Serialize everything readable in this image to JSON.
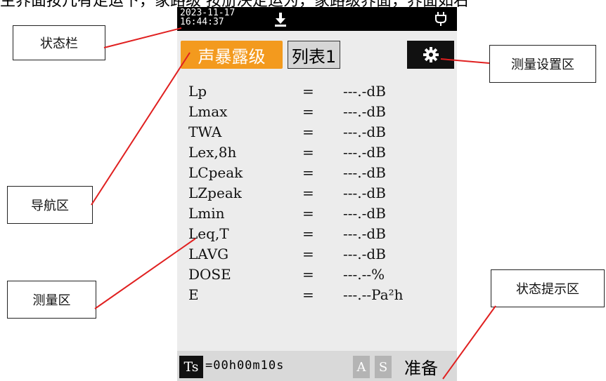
{
  "caption": "主界面按几有走运下，家路级 按册决定运为，家路级界面，界面如右",
  "callouts": {
    "status_bar": "状态栏",
    "navigation": "导航区",
    "measurement": "测量区",
    "settings": "测量设置区",
    "status_hint": "状态提示区"
  },
  "device": {
    "status_bar": {
      "date": "2023-11-17",
      "time": "16:44:37",
      "download_icon": "download-icon",
      "plug_icon": "plug-icon"
    },
    "nav": {
      "active_tab": "声暴露级",
      "list_tab": "列表1",
      "settings_icon": "gear-icon"
    },
    "measurements": [
      {
        "label": "Lp",
        "eq": "=",
        "value": "---.-dB"
      },
      {
        "label": "Lmax",
        "eq": "=",
        "value": "---.-dB"
      },
      {
        "label": "TWA",
        "eq": "=",
        "value": "---.-dB"
      },
      {
        "label": "Lex,8h",
        "eq": "=",
        "value": "---.-dB"
      },
      {
        "label": "LCpeak",
        "eq": "=",
        "value": "---.-dB"
      },
      {
        "label": "LZpeak",
        "eq": "=",
        "value": "---.-dB"
      },
      {
        "label": "Lmin",
        "eq": "=",
        "value": "---.-dB"
      },
      {
        "label": "Leq,T",
        "eq": "=",
        "value": "---.-dB"
      },
      {
        "label": "LAVG",
        "eq": "=",
        "value": "---.-dB"
      },
      {
        "label": "DOSE",
        "eq": "=",
        "value": "---.--%"
      },
      {
        "label": "E",
        "eq": "=",
        "value": "---.--Pa²h"
      }
    ],
    "bottom": {
      "ts_label": "Ts",
      "ts_value": "=00h00m10s",
      "a_indicator": "A",
      "s_indicator": "S",
      "state": "准备"
    }
  },
  "colors": {
    "accent": "#f39a1e",
    "leader_line": "#e02020",
    "panel_bg": "#ececec"
  }
}
